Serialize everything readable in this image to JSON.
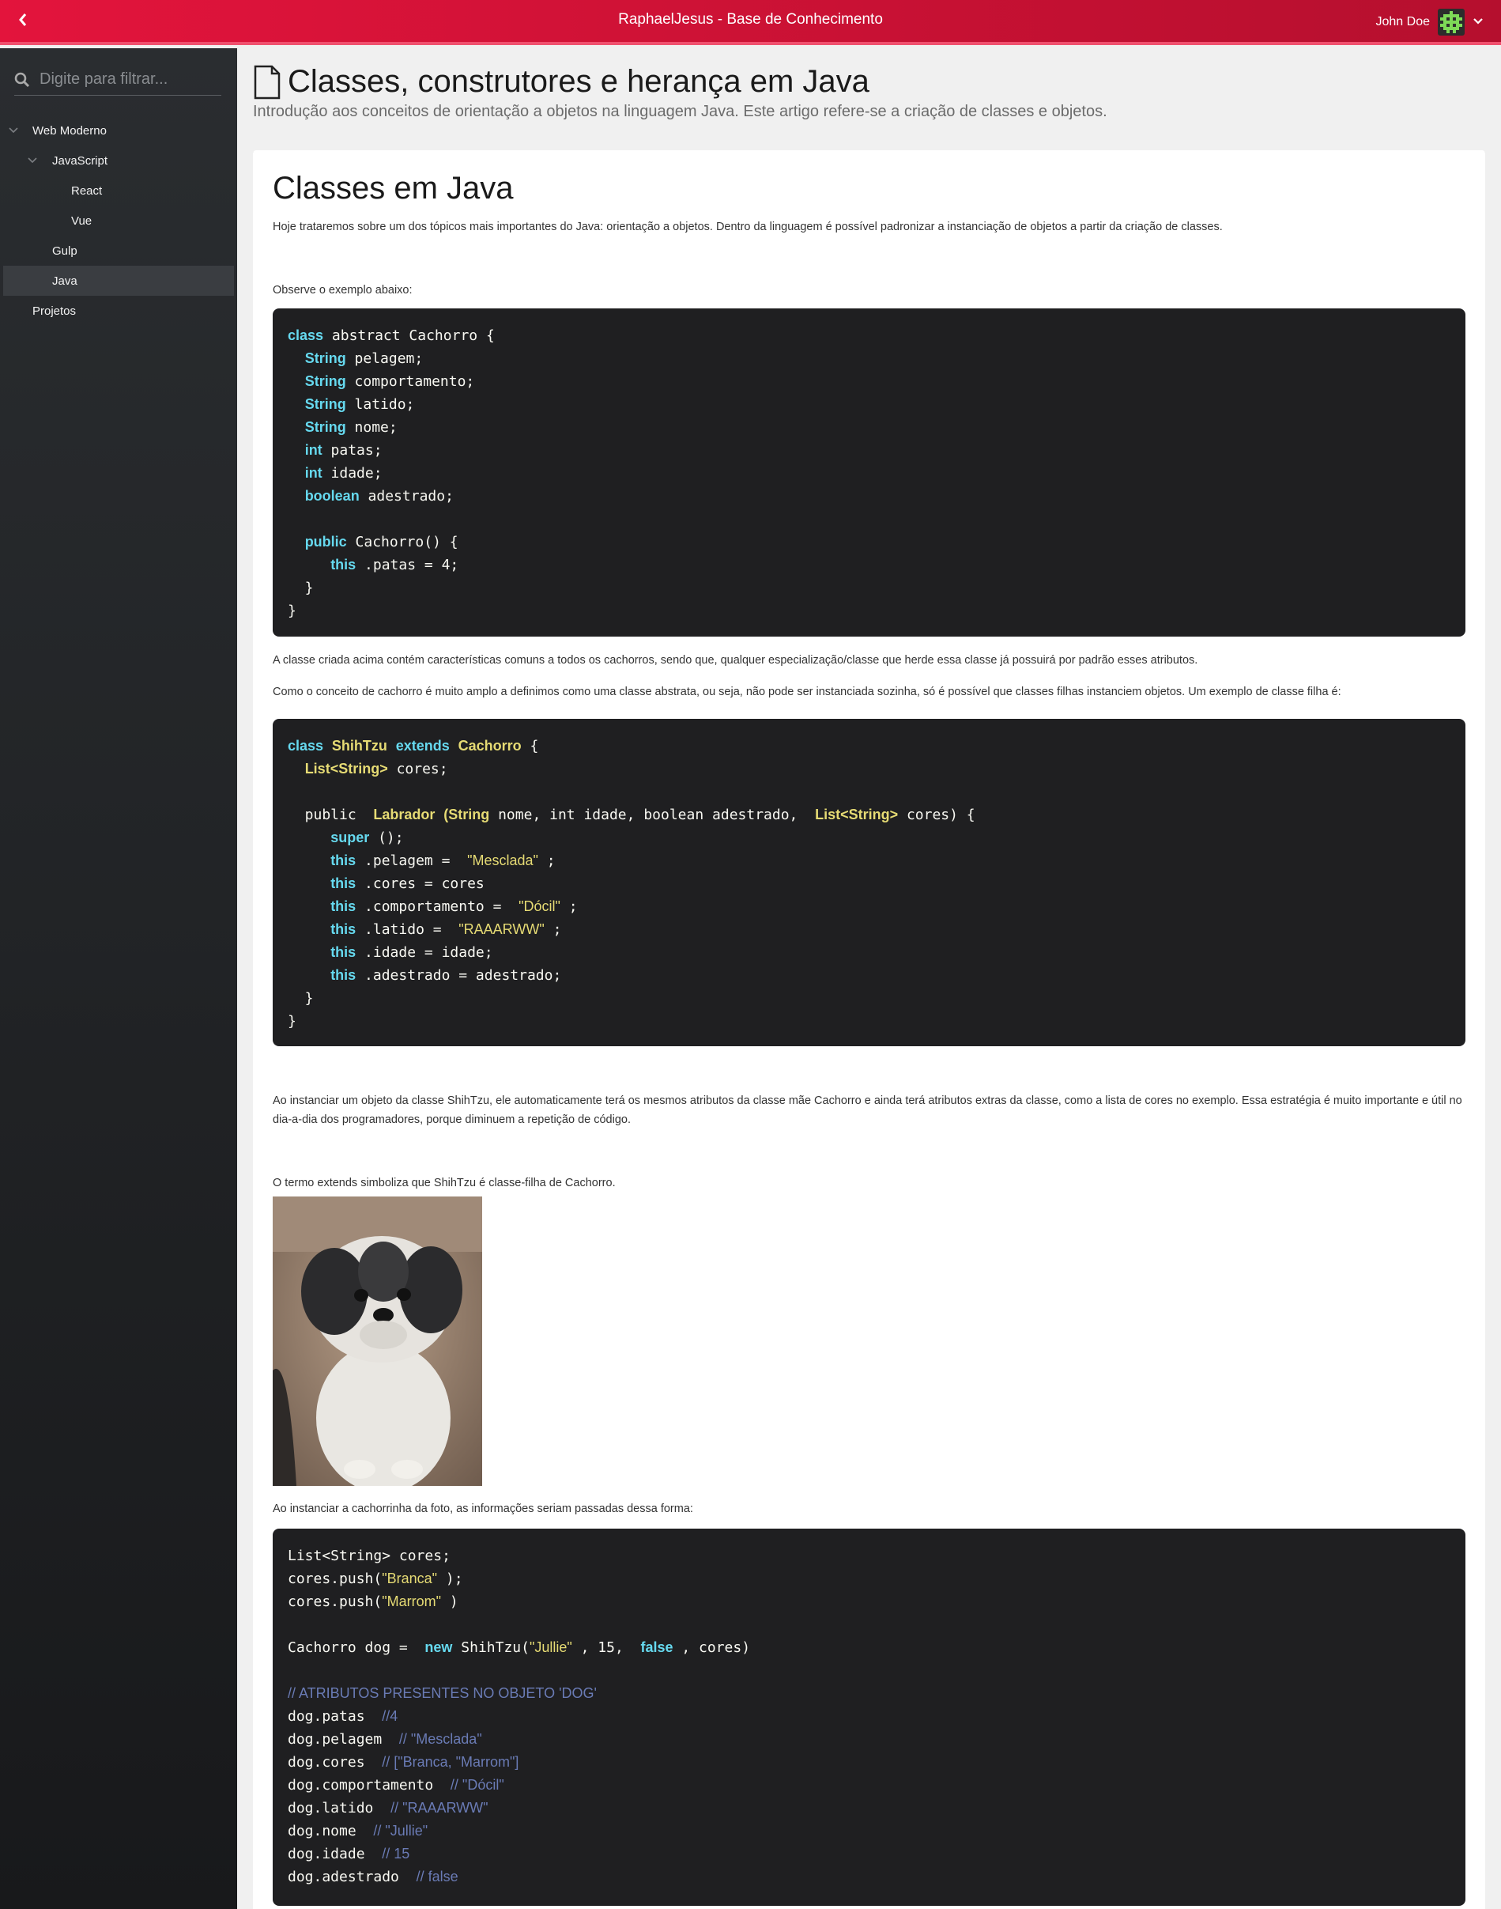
{
  "header": {
    "title": "RaphaelJesus - Base de Conhecimento",
    "user_name": "John Doe"
  },
  "sidebar": {
    "search_placeholder": "Digite para filtrar...",
    "items": [
      {
        "label": "Web Moderno"
      },
      {
        "label": "JavaScript"
      },
      {
        "label": "React"
      },
      {
        "label": "Vue"
      },
      {
        "label": "Gulp"
      },
      {
        "label": "Java"
      },
      {
        "label": "Projetos"
      }
    ]
  },
  "page": {
    "title": "Classes, construtores e herança em Java",
    "subtitle": "Introdução aos conceitos de orientação a objetos na linguagem Java. Este artigo refere-se a criação de classes e objetos."
  },
  "article": {
    "heading": "Classes em Java",
    "p1": "Hoje trataremos sobre um dos tópicos mais importantes do Java: orientação a objetos. Dentro da linguagem é possível padronizar a instanciação de objetos a partir da criação de classes.",
    "p2": "Observe o exemplo abaixo:",
    "p3": "A classe criada acima contém características comuns a todos os cachorros, sendo que, qualquer especialização/classe que herde essa classe já possuirá por padrão esses atributos.",
    "p4": "Como o conceito de cachorro é muito amplo a definimos como uma classe abstrata, ou seja, não pode ser instanciada sozinha, só é possível que classes filhas instanciem objetos. Um exemplo de classe filha é:",
    "p5": "Ao instanciar um objeto da classe ShihTzu, ele automaticamente terá os mesmos atributos da classe mãe Cachorro e ainda terá atributos extras da classe, como a lista de cores no exemplo. Essa estratégia é muito importante e útil no dia-a-dia dos programadores, porque diminuem a repetição de código.",
    "p6": "O termo extends simboliza que ShihTzu é classe-filha de Cachorro.",
    "p7": "Ao instanciar a cachorrinha da foto, as informações seriam passadas dessa forma:"
  },
  "code1": [
    [
      [
        "kw",
        "class"
      ],
      [
        "",
        "abstract Cachorro {"
      ]
    ],
    [
      [
        "",
        "  "
      ],
      [
        "kw",
        "String"
      ],
      [
        "",
        "pelagem;"
      ]
    ],
    [
      [
        "",
        "  "
      ],
      [
        "kw",
        "String"
      ],
      [
        "",
        "comportamento;"
      ]
    ],
    [
      [
        "",
        "  "
      ],
      [
        "kw",
        "String"
      ],
      [
        "",
        "latido;"
      ]
    ],
    [
      [
        "",
        "  "
      ],
      [
        "kw",
        "String"
      ],
      [
        "",
        "nome;"
      ]
    ],
    [
      [
        "",
        "  "
      ],
      [
        "kw",
        "int"
      ],
      [
        "",
        "patas;"
      ]
    ],
    [
      [
        "",
        "  "
      ],
      [
        "kw",
        "int"
      ],
      [
        "",
        "idade;"
      ]
    ],
    [
      [
        "",
        "  "
      ],
      [
        "kw",
        "boolean"
      ],
      [
        "",
        "adestrado;"
      ]
    ],
    [
      [
        "",
        ""
      ]
    ],
    [
      [
        "",
        "  "
      ],
      [
        "kw",
        "public"
      ],
      [
        "",
        "Cachorro() {"
      ]
    ],
    [
      [
        "",
        "     "
      ],
      [
        "kw",
        "this"
      ],
      [
        "",
        ".patas = 4;"
      ]
    ],
    [
      [
        "",
        "  }"
      ]
    ],
    [
      [
        "",
        "}"
      ]
    ]
  ],
  "code2": [
    [
      [
        "kw",
        "class"
      ],
      [
        "ty",
        "ShihTzu"
      ],
      [
        "kw",
        "extends"
      ],
      [
        "ty",
        "Cachorro"
      ],
      [
        "",
        "{"
      ]
    ],
    [
      [
        "",
        "  "
      ],
      [
        "ty",
        "List<String>"
      ],
      [
        "",
        "cores;"
      ]
    ],
    [
      [
        "",
        ""
      ]
    ],
    [
      [
        "",
        "  public "
      ],
      [
        "ty",
        "Labrador"
      ],
      [
        "ty",
        "(String"
      ],
      [
        "",
        "nome, int idade, boolean adestrado, "
      ],
      [
        "ty",
        "List<String>"
      ],
      [
        "",
        "cores) {"
      ]
    ],
    [
      [
        "",
        "     "
      ],
      [
        "kw",
        "super"
      ],
      [
        "",
        "();"
      ]
    ],
    [
      [
        "",
        "     "
      ],
      [
        "kw",
        "this"
      ],
      [
        "",
        ".pelagem = "
      ],
      [
        "st",
        "\"Mesclada\""
      ],
      [
        "",
        ";"
      ]
    ],
    [
      [
        "",
        "     "
      ],
      [
        "kw",
        "this"
      ],
      [
        "",
        ".cores = cores"
      ]
    ],
    [
      [
        "",
        "     "
      ],
      [
        "kw",
        "this"
      ],
      [
        "",
        ".comportamento = "
      ],
      [
        "st",
        "\"Dócil\""
      ],
      [
        "",
        ";"
      ]
    ],
    [
      [
        "",
        "     "
      ],
      [
        "kw",
        "this"
      ],
      [
        "",
        ".latido = "
      ],
      [
        "st",
        "\"RAAARWW\""
      ],
      [
        "",
        ";"
      ]
    ],
    [
      [
        "",
        "     "
      ],
      [
        "kw",
        "this"
      ],
      [
        "",
        ".idade = idade;"
      ]
    ],
    [
      [
        "",
        "     "
      ],
      [
        "kw",
        "this"
      ],
      [
        "",
        ".adestrado = adestrado;"
      ]
    ],
    [
      [
        "",
        "  }"
      ]
    ],
    [
      [
        "",
        "}"
      ]
    ]
  ],
  "code3": [
    [
      [
        "",
        "List<String> cores;"
      ]
    ],
    [
      [
        "",
        "cores.push("
      ],
      [
        "st",
        "\"Branca\""
      ],
      [
        "",
        ");"
      ]
    ],
    [
      [
        "",
        "cores.push("
      ],
      [
        "st",
        "\"Marrom\""
      ],
      [
        "",
        ")"
      ]
    ],
    [
      [
        "",
        ""
      ]
    ],
    [
      [
        "",
        "Cachorro dog = "
      ],
      [
        "kw",
        "new"
      ],
      [
        "",
        "ShihTzu("
      ],
      [
        "st",
        "\"Jullie\""
      ],
      [
        "",
        ", 15, "
      ],
      [
        "kw",
        "false"
      ],
      [
        "",
        ", cores)"
      ]
    ],
    [
      [
        "",
        ""
      ]
    ],
    [
      [
        "cm",
        "// ATRIBUTOS PRESENTES NO OBJETO 'DOG'"
      ]
    ],
    [
      [
        "",
        "dog.patas "
      ],
      [
        "cm",
        "//4"
      ]
    ],
    [
      [
        "",
        "dog.pelagem "
      ],
      [
        "cm",
        "// \"Mesclada\""
      ]
    ],
    [
      [
        "",
        "dog.cores "
      ],
      [
        "cm",
        "// [\"Branca, \"Marrom\"]"
      ]
    ],
    [
      [
        "",
        "dog.comportamento "
      ],
      [
        "cm",
        "// \"Dócil\""
      ]
    ],
    [
      [
        "",
        "dog.latido "
      ],
      [
        "cm",
        "// \"RAAARWW\""
      ]
    ],
    [
      [
        "",
        "dog.nome "
      ],
      [
        "cm",
        "// \"Jullie\""
      ]
    ],
    [
      [
        "",
        "dog.idade "
      ],
      [
        "cm",
        "// 15"
      ]
    ],
    [
      [
        "",
        "dog.adestrado "
      ],
      [
        "cm",
        "// false"
      ]
    ]
  ]
}
